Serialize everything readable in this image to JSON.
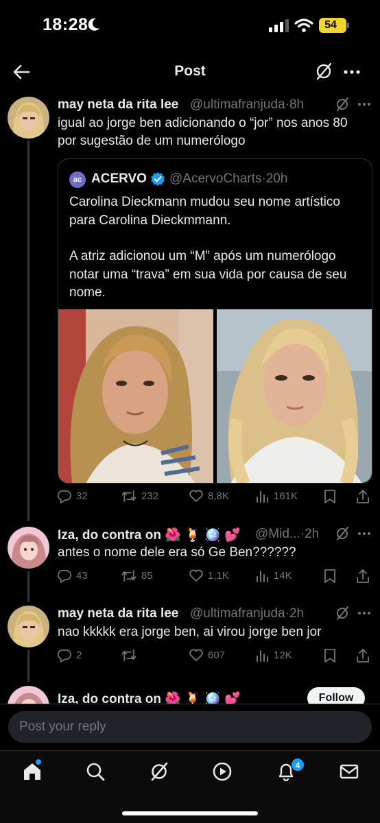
{
  "status_bar": {
    "time": "18:28",
    "battery": "54"
  },
  "header": {
    "title": "Post"
  },
  "posts": [
    {
      "name": "may neta da rita lee",
      "handle": "@ultimafranjuda",
      "sep": "·",
      "time": "8h",
      "text": "igual ao jorge ben adicionando o “jor” nos anos 80 por sugestão de um numerólogo",
      "quote": {
        "logo": "ac",
        "name": "ACERVO",
        "handle": "@AcervoCharts",
        "sep": "·",
        "time": "20h",
        "text1": "Carolina Dieckmann mudou seu nome artístico para Carolina Dieckmmann.",
        "text2": "A atriz adicionou um “M” após um numerólogo notar uma “trava” em sua vida por causa de seu nome."
      },
      "stats": {
        "replies": "32",
        "reposts": "232",
        "likes": "8,8K",
        "views": "161K"
      }
    },
    {
      "name": "Iza, do contra on 🌺 🍹 🪩 💕",
      "handle": "@Mid...",
      "sep": "·",
      "time": "2h",
      "text": "antes o nome dele era só Ge Ben??????",
      "stats": {
        "replies": "43",
        "reposts": "85",
        "likes": "1,1K",
        "views": "14K"
      }
    },
    {
      "name": "may neta da rita lee",
      "handle": "@ultimafranjuda",
      "sep": "·",
      "time": "2h",
      "text": "nao kkkkk era jorge ben, ai virou jorge ben jor",
      "stats": {
        "replies": "2",
        "reposts": "",
        "likes": "607",
        "views": "12K"
      }
    },
    {
      "name": "Iza, do contra on 🌺 🍹 🪩 💕",
      "follow_label": "Follow"
    }
  ],
  "reply": {
    "placeholder": "Post your reply"
  },
  "tabbar": {
    "notifications_badge": "4"
  },
  "colors": {
    "background": "#000000",
    "text": "#e7e9ea",
    "muted": "#71767b",
    "accent": "#1d9bf0",
    "battery": "#f4d32f"
  },
  "icons": [
    "back-arrow-icon",
    "grok-icon",
    "more-icon",
    "reply-icon",
    "repost-icon",
    "like-icon",
    "views-icon",
    "bookmark-icon",
    "share-icon",
    "home-icon",
    "search-icon",
    "play-icon",
    "bell-icon",
    "mail-icon",
    "verified-icon"
  ]
}
